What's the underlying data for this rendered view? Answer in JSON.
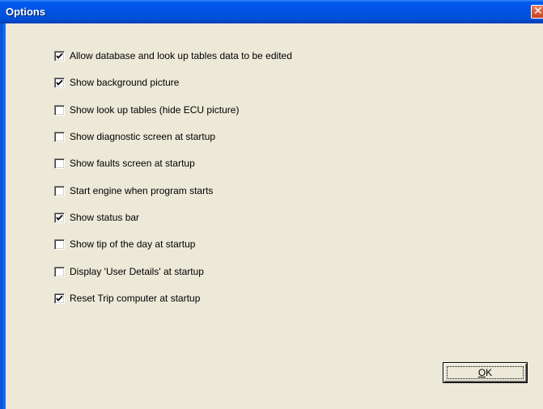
{
  "window": {
    "title": "Options"
  },
  "options": [
    {
      "label": "Allow database and  look up tables data to be edited",
      "checked": true
    },
    {
      "label": "Show background picture",
      "checked": true
    },
    {
      "label": "Show look up tables (hide ECU picture)",
      "checked": false
    },
    {
      "label": "Show diagnostic screen at startup",
      "checked": false
    },
    {
      "label": "Show faults screen at startup",
      "checked": false
    },
    {
      "label": "Start engine when program starts",
      "checked": false
    },
    {
      "label": "Show status bar",
      "checked": true
    },
    {
      "label": "Show tip of the day at startup",
      "checked": false
    },
    {
      "label": "Display 'User Details' at startup",
      "checked": false
    },
    {
      "label": "Reset Trip computer at startup",
      "checked": true
    }
  ],
  "buttons": {
    "ok_mnemonic": "O",
    "ok_rest": "K"
  },
  "icons": {
    "close": "close-icon",
    "check": "check-icon"
  },
  "colors": {
    "titlebar": "#0054e3",
    "face": "#ece9d8",
    "close": "#e05a3a"
  }
}
